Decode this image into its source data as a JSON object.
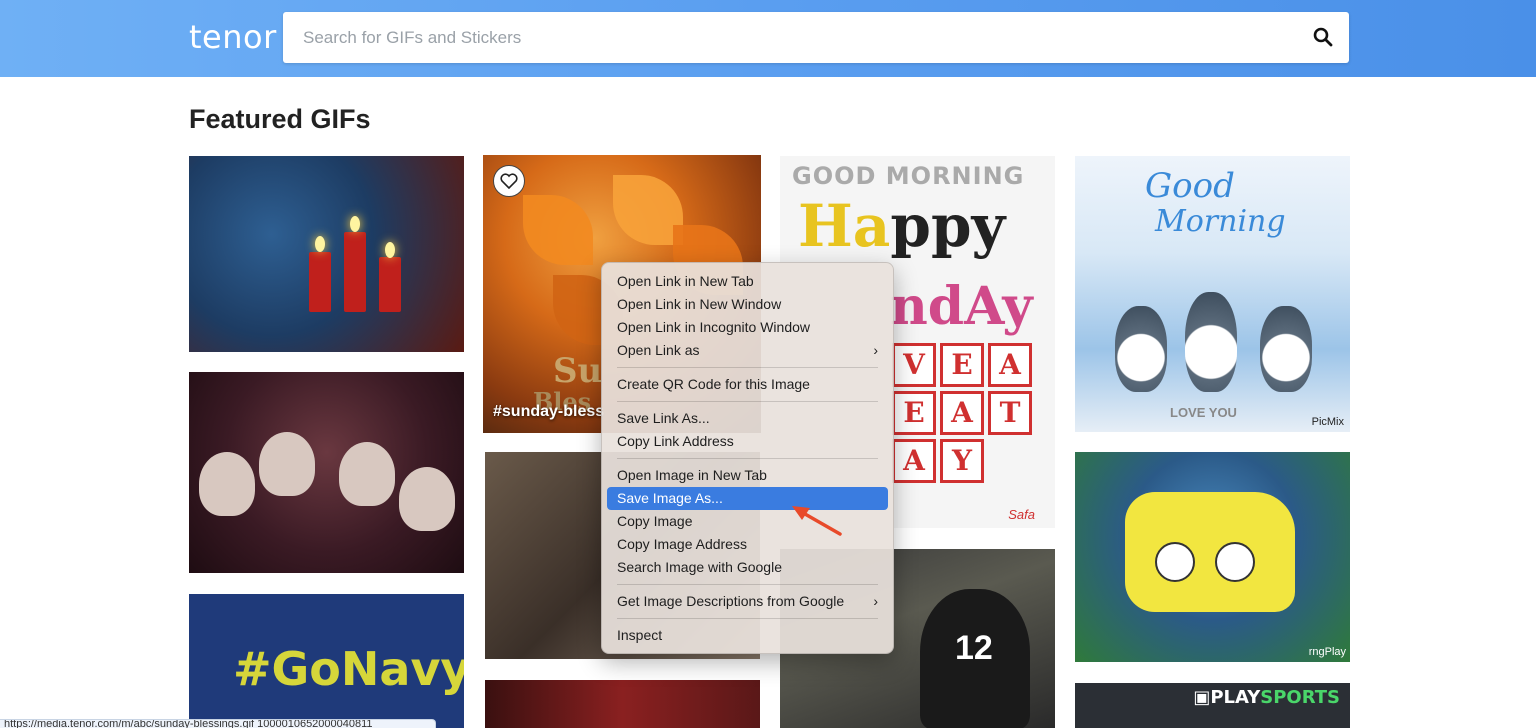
{
  "header": {
    "logo": "tenor",
    "search_placeholder": "Search for GIFs and Stickers",
    "search_icon": "search-icon"
  },
  "main": {
    "heading": "Featured GIFs"
  },
  "tiles": {
    "sunday": {
      "tag": "#sunday-bless",
      "overlay": "Su",
      "overlay2": "Bles"
    },
    "happy_sunday": {
      "line1": "GOOD MORNING",
      "line2a": "Ha",
      "line2b": "ppy",
      "line3": "ndAy",
      "row1": [
        "V",
        "E",
        "A"
      ],
      "row2": [
        "E",
        "A",
        "T"
      ],
      "row3": [
        "A",
        "Y"
      ],
      "signature": "Safa"
    },
    "good_morning": {
      "line1": "Good",
      "line2": "Morning",
      "caption": "LOVE YOU",
      "watermark": "PicMix"
    },
    "gonavy": {
      "text": "#GoNavy"
    },
    "playsports": {
      "prefix": "▣",
      "brand_a": "PLAY",
      "brand_b": "SPORTS"
    },
    "spongebob": {
      "watermark": "rngPlay"
    },
    "football": {
      "number": "12"
    }
  },
  "context_menu": {
    "groups": [
      [
        {
          "label": "Open Link in New Tab"
        },
        {
          "label": "Open Link in New Window"
        },
        {
          "label": "Open Link in Incognito Window"
        },
        {
          "label": "Open Link as",
          "submenu": true
        }
      ],
      [
        {
          "label": "Create QR Code for this Image"
        }
      ],
      [
        {
          "label": "Save Link As..."
        },
        {
          "label": "Copy Link Address"
        }
      ],
      [
        {
          "label": "Open Image in New Tab"
        },
        {
          "label": "Save Image As...",
          "highlighted": true
        },
        {
          "label": "Copy Image"
        },
        {
          "label": "Copy Image Address"
        },
        {
          "label": "Search Image with Google"
        }
      ],
      [
        {
          "label": "Get Image Descriptions from Google",
          "submenu": true
        }
      ],
      [
        {
          "label": "Inspect"
        }
      ]
    ],
    "chevron": "›",
    "highlight_color": "#3a7ce0"
  },
  "annotation": {
    "arrow_color": "#e84a2a"
  },
  "status_bar": {
    "url": "https://media.tenor.com/m/abc/sunday-blessings.gif 1000010652000040811"
  },
  "colors": {
    "header_bg": "#5a9ef0",
    "heading": "#222222"
  }
}
